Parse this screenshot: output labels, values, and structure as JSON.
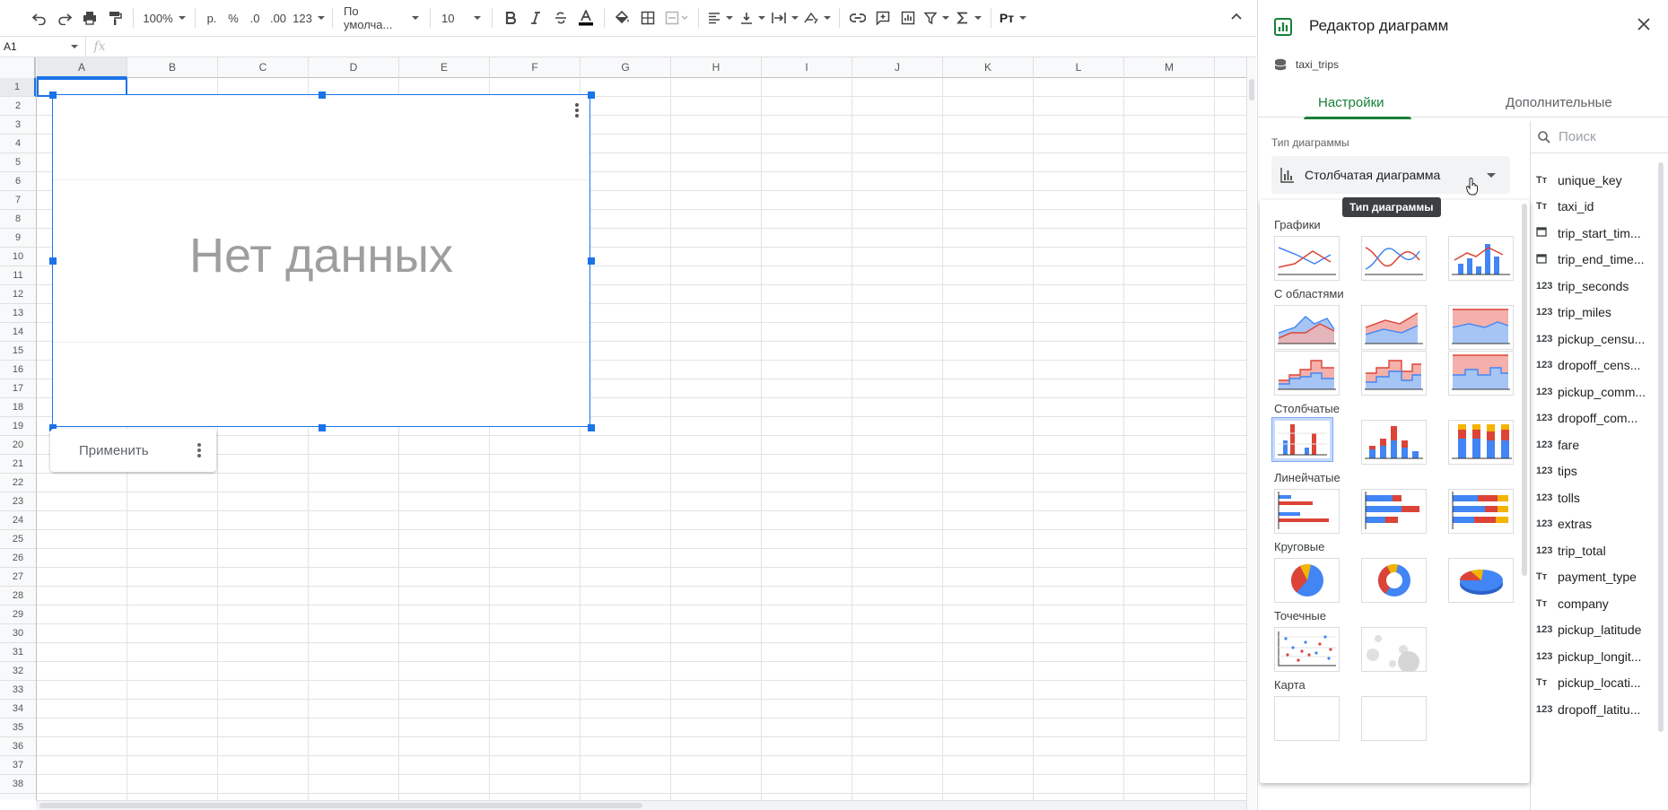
{
  "toolbar": {
    "zoom": "100%",
    "currency": "р.",
    "percent": "%",
    "dec_decrease": ".0",
    "dec_increase": ".00",
    "number_format": "123",
    "font_name": "По умолча...",
    "font_size": "10",
    "script_label": "Рт"
  },
  "formula_bar": {
    "cell_ref": "A1",
    "fx": "fx"
  },
  "sheet": {
    "columns": [
      "A",
      "B",
      "C",
      "D",
      "E",
      "F",
      "G",
      "H",
      "I",
      "J",
      "K",
      "L",
      "M"
    ],
    "rows": [
      "1",
      "2",
      "3",
      "4",
      "5",
      "6",
      "7",
      "8",
      "9",
      "10",
      "11",
      "12",
      "13",
      "14",
      "15",
      "16",
      "17",
      "18",
      "19",
      "20",
      "21",
      "22",
      "23",
      "24",
      "25",
      "26",
      "27",
      "28",
      "29",
      "30",
      "31",
      "32",
      "33",
      "34",
      "35",
      "36",
      "37",
      "38"
    ],
    "selected_cell": "A1"
  },
  "chart": {
    "no_data_text": "Нет данных"
  },
  "apply_box": {
    "apply_label": "Применить"
  },
  "panel": {
    "title": "Редактор диаграмм",
    "source": "taxi_trips",
    "tabs": [
      {
        "label": "Настройки",
        "active": true
      },
      {
        "label": "Дополнительные",
        "active": false
      }
    ],
    "chart_type_label": "Тип диаграммы",
    "chart_type_value": "Столбчатая диаграмма",
    "tooltip": "Тип диаграммы",
    "popup_sections": [
      "Графики",
      "С областями",
      "Столбчатые",
      "Линейчатые",
      "Круговые",
      "Точечные",
      "Карта"
    ],
    "search_placeholder": "Поиск",
    "fields": [
      {
        "type": "text",
        "icon": "Тт",
        "name": "unique_key"
      },
      {
        "type": "text",
        "icon": "Тт",
        "name": "taxi_id"
      },
      {
        "type": "date",
        "icon": "📅",
        "name": "trip_start_tim..."
      },
      {
        "type": "date",
        "icon": "📅",
        "name": "trip_end_time..."
      },
      {
        "type": "number",
        "icon": "123",
        "name": "trip_seconds"
      },
      {
        "type": "number",
        "icon": "123",
        "name": "trip_miles"
      },
      {
        "type": "number",
        "icon": "123",
        "name": "pickup_censu..."
      },
      {
        "type": "number",
        "icon": "123",
        "name": "dropoff_cens..."
      },
      {
        "type": "number",
        "icon": "123",
        "name": "pickup_comm..."
      },
      {
        "type": "number",
        "icon": "123",
        "name": "dropoff_com..."
      },
      {
        "type": "number",
        "icon": "123",
        "name": "fare"
      },
      {
        "type": "number",
        "icon": "123",
        "name": "tips"
      },
      {
        "type": "number",
        "icon": "123",
        "name": "tolls"
      },
      {
        "type": "number",
        "icon": "123",
        "name": "extras"
      },
      {
        "type": "number",
        "icon": "123",
        "name": "trip_total"
      },
      {
        "type": "text",
        "icon": "Тт",
        "name": "payment_type"
      },
      {
        "type": "text",
        "icon": "Тт",
        "name": "company"
      },
      {
        "type": "number",
        "icon": "123",
        "name": "pickup_latitude"
      },
      {
        "type": "number",
        "icon": "123",
        "name": "pickup_longit..."
      },
      {
        "type": "text",
        "icon": "Тт",
        "name": "pickup_locati..."
      },
      {
        "type": "number",
        "icon": "123",
        "name": "dropoff_latitu..."
      }
    ]
  },
  "colors": {
    "accent": "#1a73e8",
    "green": "#188038",
    "red": "#db4437",
    "blue": "#4285f4",
    "yellow": "#f4b400"
  }
}
